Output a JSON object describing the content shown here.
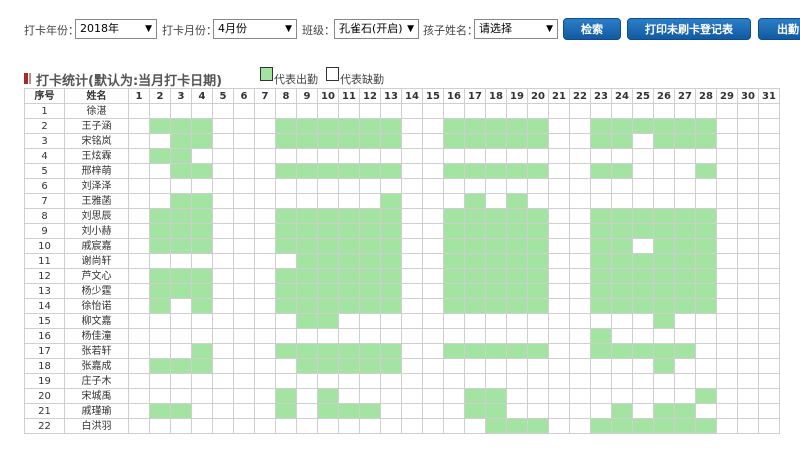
{
  "filters": {
    "year_label": "打卡年份：",
    "year_value": "2018年",
    "month_label": "打卡月份：",
    "month_value": "4月份",
    "class_label": "班级：",
    "class_value": "孔雀石(开启)",
    "child_label": "孩子姓名：",
    "child_value": "请选择"
  },
  "buttons": {
    "search": "检索",
    "print": "打印未刷卡登记表",
    "export": "出勤"
  },
  "stats": {
    "title": "打卡统计(默认为:当月打卡日期)",
    "legend_present": "代表出勤",
    "legend_absent": "代表缺勤"
  },
  "colors": {
    "present": "#a3e4a3",
    "absent": "#ffffff",
    "button": "#1e6fb8",
    "marker": "#a62a2a"
  },
  "table": {
    "col_index": "序号",
    "col_name": "姓名",
    "days": [
      "1",
      "2",
      "3",
      "4",
      "5",
      "6",
      "7",
      "8",
      "9",
      "10",
      "11",
      "12",
      "13",
      "14",
      "15",
      "16",
      "17",
      "18",
      "19",
      "20",
      "21",
      "22",
      "23",
      "24",
      "25",
      "26",
      "27",
      "28",
      "29",
      "30",
      "31"
    ],
    "rows": [
      {
        "index": "1",
        "name": "徐湛",
        "present": []
      },
      {
        "index": "2",
        "name": "王子涵",
        "present": [
          2,
          3,
          4,
          8,
          9,
          10,
          11,
          12,
          13,
          16,
          17,
          18,
          19,
          20,
          23,
          24,
          25,
          26,
          27,
          28
        ]
      },
      {
        "index": "3",
        "name": "宋铭岚",
        "present": [
          3,
          4,
          8,
          9,
          10,
          11,
          12,
          13,
          16,
          17,
          18,
          19,
          20,
          23,
          24,
          26,
          27,
          28
        ]
      },
      {
        "index": "4",
        "name": "王炫霖",
        "present": [
          2,
          3
        ]
      },
      {
        "index": "5",
        "name": "邢梓萌",
        "present": [
          3,
          4,
          8,
          9,
          10,
          11,
          12,
          13,
          16,
          17,
          18,
          19,
          20,
          23,
          24,
          28
        ]
      },
      {
        "index": "6",
        "name": "刘泽泽",
        "present": []
      },
      {
        "index": "7",
        "name": "王雅菡",
        "present": [
          3,
          4,
          13,
          17,
          19
        ]
      },
      {
        "index": "8",
        "name": "刘思辰",
        "present": [
          2,
          3,
          4,
          8,
          9,
          10,
          11,
          12,
          13,
          16,
          17,
          18,
          19,
          20,
          23,
          24,
          25,
          26,
          27,
          28
        ]
      },
      {
        "index": "9",
        "name": "刘小赫",
        "present": [
          2,
          3,
          4,
          8,
          9,
          10,
          11,
          12,
          13,
          16,
          17,
          18,
          19,
          20,
          23,
          24,
          25,
          26,
          27,
          28
        ]
      },
      {
        "index": "10",
        "name": "戚宸嘉",
        "present": [
          2,
          3,
          4,
          8,
          9,
          10,
          11,
          12,
          13,
          16,
          17,
          18,
          19,
          20,
          23,
          24,
          26,
          27,
          28
        ]
      },
      {
        "index": "11",
        "name": "谢尚轩",
        "present": [
          9,
          10,
          11,
          12,
          13,
          16,
          17,
          18,
          19,
          20,
          23,
          24,
          25,
          26,
          27,
          28
        ]
      },
      {
        "index": "12",
        "name": "芦文心",
        "present": [
          2,
          3,
          4,
          8,
          9,
          10,
          11,
          12,
          13,
          16,
          17,
          18,
          19,
          20,
          23,
          24,
          25,
          26,
          27,
          28
        ]
      },
      {
        "index": "13",
        "name": "杨少霆",
        "present": [
          2,
          3,
          4,
          8,
          9,
          10,
          11,
          12,
          13,
          16,
          17,
          18,
          19,
          20,
          23,
          24,
          25,
          26,
          27,
          28
        ]
      },
      {
        "index": "14",
        "name": "徐怡诺",
        "present": [
          2,
          4,
          8,
          9,
          10,
          11,
          12,
          13,
          16,
          17,
          18,
          19,
          20,
          23,
          24,
          25,
          26,
          27,
          28
        ]
      },
      {
        "index": "15",
        "name": "柳文嘉",
        "present": [
          9,
          10,
          26
        ]
      },
      {
        "index": "16",
        "name": "杨佳潼",
        "present": [
          23
        ]
      },
      {
        "index": "17",
        "name": "张若轩",
        "present": [
          4,
          8,
          9,
          10,
          11,
          12,
          13,
          16,
          17,
          18,
          19,
          20,
          23,
          24,
          25,
          26,
          27
        ]
      },
      {
        "index": "18",
        "name": "张嘉成",
        "present": [
          2,
          3,
          4,
          9,
          10,
          11,
          12,
          13,
          26
        ]
      },
      {
        "index": "19",
        "name": "庄子木",
        "present": []
      },
      {
        "index": "20",
        "name": "宋城禹",
        "present": [
          8,
          10,
          17,
          18,
          28
        ]
      },
      {
        "index": "21",
        "name": "戚瑾瑜",
        "present": [
          2,
          3,
          8,
          10,
          11,
          12,
          17,
          18,
          24,
          26,
          27
        ]
      },
      {
        "index": "22",
        "name": "白洪羽",
        "present": [
          18,
          19,
          20,
          23,
          24,
          25,
          26,
          27,
          28
        ]
      }
    ]
  }
}
